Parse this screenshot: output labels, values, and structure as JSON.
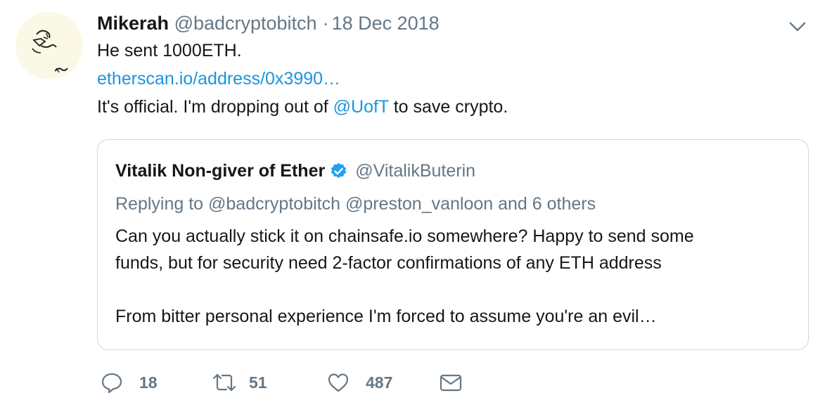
{
  "tweet": {
    "author_name": "Mikerah",
    "handle": "@badcryptobitch",
    "separator": "·",
    "date": "18 Dec 2018",
    "line1": "He sent 1000ETH.",
    "link_text": "etherscan.io/address/0x3990…",
    "line3_before": "It's official. I'm dropping out of ",
    "mention": "@UofT",
    "line3_after": " to save crypto."
  },
  "quote": {
    "author_name": "Vitalik Non-giver of Ether",
    "handle": "@VitalikButerin",
    "replying_to": "Replying to @badcryptobitch @preston_vanloon and 6 others",
    "text_line1": "Can you actually stick it on chainsafe.io somewhere? Happy to send some",
    "text_line2": "funds, but for security need 2-factor confirmations of any ETH address",
    "text_line3": "From bitter personal experience I'm forced to assume you're an evil…"
  },
  "actions": {
    "reply_count": "18",
    "retweet_count": "51",
    "like_count": "487"
  },
  "icons": {
    "menu": "chevron-down-icon",
    "verified": "verified-badge-icon",
    "reply": "reply-icon",
    "retweet": "retweet-icon",
    "like": "heart-icon",
    "dm": "envelope-icon"
  },
  "colors": {
    "link": "#1b95e0",
    "secondary_text": "#657786",
    "border": "#ccd6dd",
    "verified": "#1da1f2"
  }
}
